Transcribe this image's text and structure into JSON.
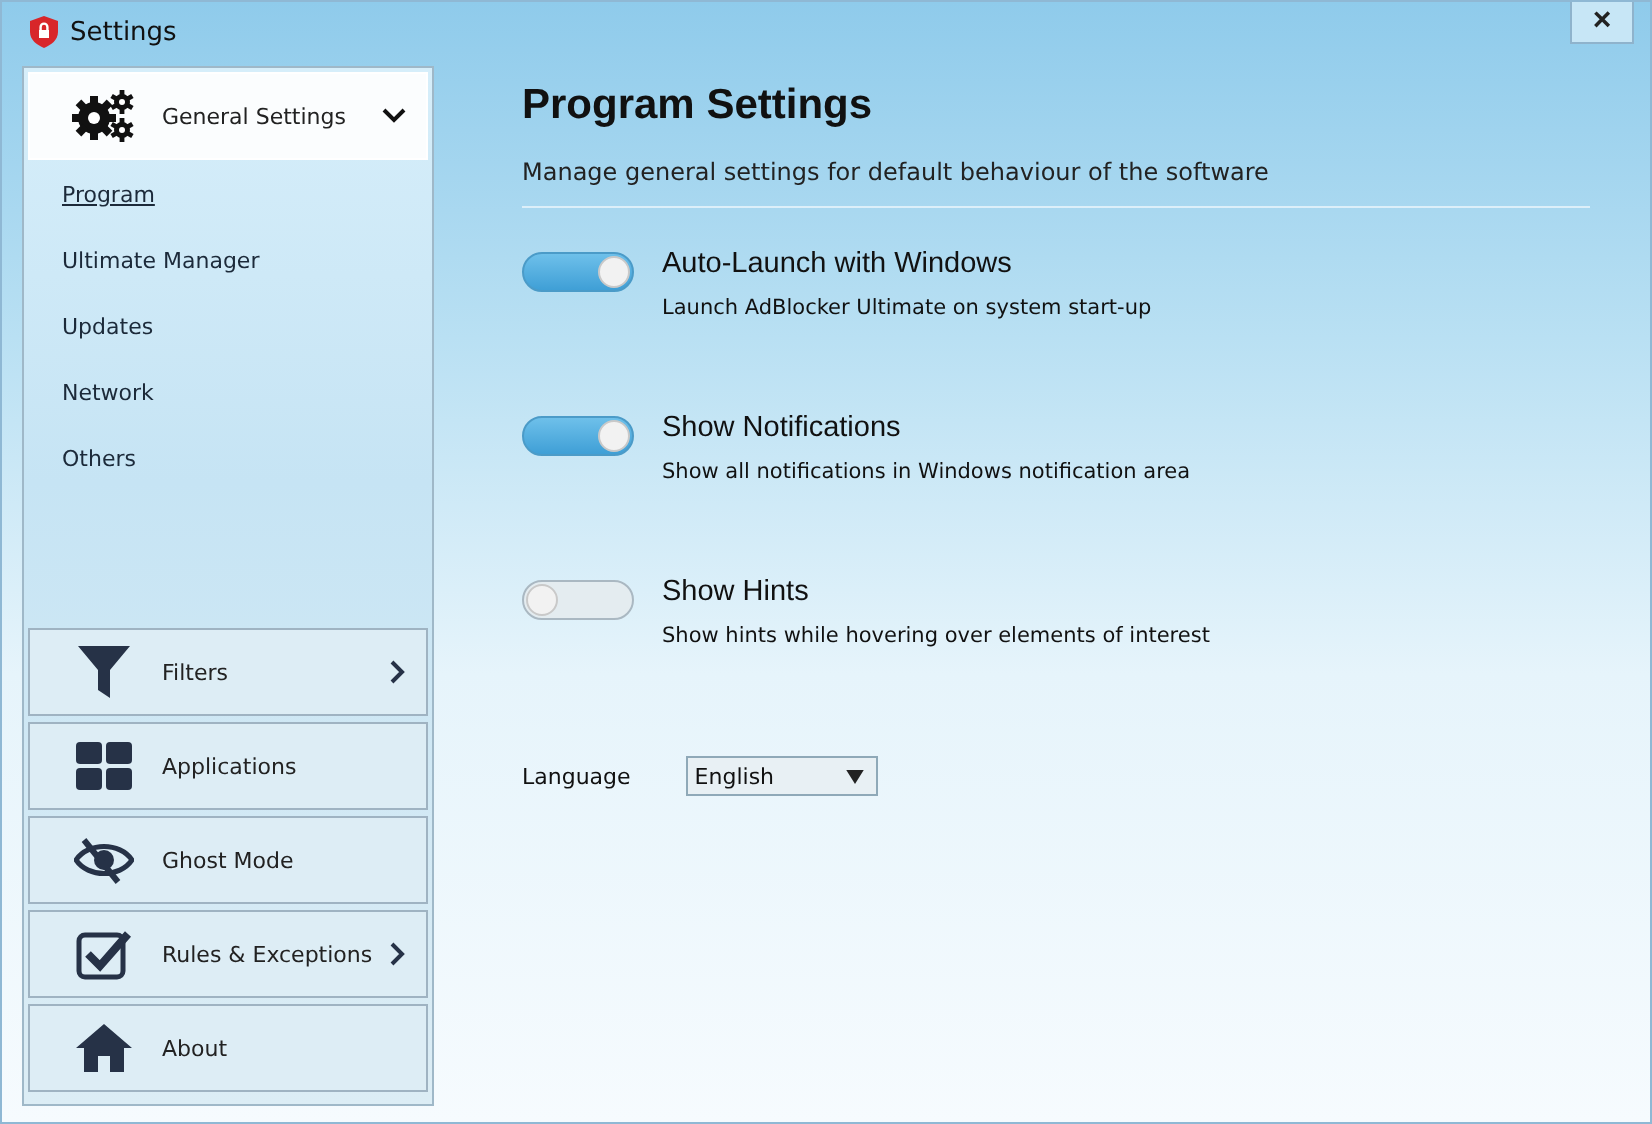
{
  "window": {
    "title": "Settings",
    "close": "×"
  },
  "sidebar": {
    "sections": [
      {
        "label": "General Settings",
        "expanded": true,
        "selected": true,
        "items": [
          {
            "label": "Program",
            "selected": true
          },
          {
            "label": "Ultimate Manager",
            "selected": false
          },
          {
            "label": "Updates",
            "selected": false
          },
          {
            "label": "Network",
            "selected": false
          },
          {
            "label": "Others",
            "selected": false
          }
        ]
      },
      {
        "label": "Filters",
        "expanded": false,
        "selected": false
      },
      {
        "label": "Applications",
        "selected": false
      },
      {
        "label": "Ghost Mode",
        "selected": false
      },
      {
        "label": "Rules & Exceptions",
        "expanded": false,
        "selected": false
      },
      {
        "label": "About",
        "selected": false
      }
    ]
  },
  "content": {
    "title": "Program Settings",
    "subtitle": "Manage general settings for default behaviour of the software",
    "options": [
      {
        "label": "Auto-Launch with Windows",
        "description": "Launch AdBlocker Ultimate on system start-up",
        "on": true
      },
      {
        "label": "Show Notifications",
        "description": "Show all notifications in Windows notification area",
        "on": true
      },
      {
        "label": "Show Hints",
        "description": "Show hints while hovering over elements of interest",
        "on": false
      }
    ],
    "language": {
      "label": "Language",
      "value": "English"
    }
  }
}
